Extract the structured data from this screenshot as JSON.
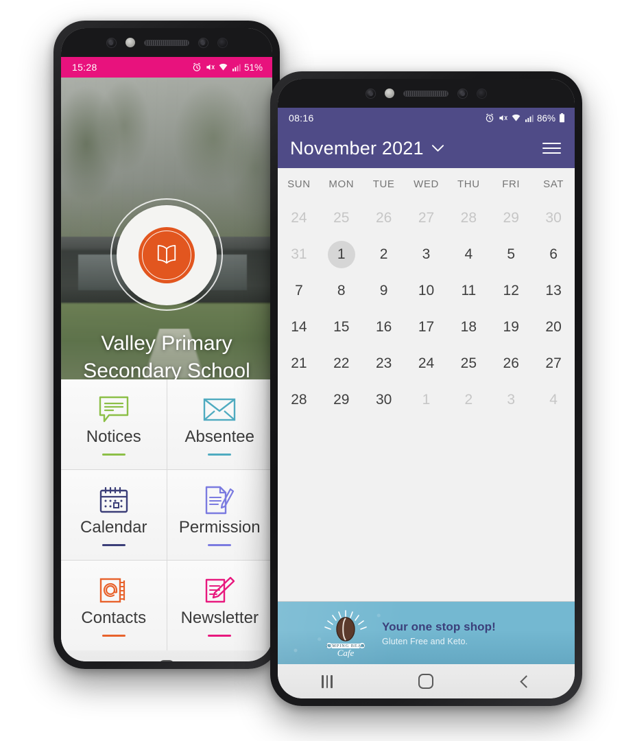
{
  "left_phone": {
    "status_bar": {
      "time": "15:28",
      "battery_text": "51%",
      "bg_color": "#e8127d",
      "icons": [
        "alarm-icon",
        "mute-icon",
        "wifi-icon",
        "signal-icon",
        "battery-icon"
      ]
    },
    "hero": {
      "logo_icon": "open-book-icon",
      "logo_color": "#e2561f",
      "school_name_line1": "Valley Primary",
      "school_name_line2": "Secondary School"
    },
    "tiles": [
      {
        "label": "Notices",
        "icon": "speech-bubble-icon",
        "color": "#8cbf47"
      },
      {
        "label": "Absentee",
        "icon": "envelope-icon",
        "color": "#4fabc0"
      },
      {
        "label": "Calendar",
        "icon": "calendar-icon",
        "color": "#3b3e78"
      },
      {
        "label": "Permission",
        "icon": "document-pen-icon",
        "color": "#7b7be0"
      },
      {
        "label": "Contacts",
        "icon": "at-address-book-icon",
        "color": "#e8622c"
      },
      {
        "label": "Newsletter",
        "icon": "note-pencil-icon",
        "color": "#e8197e"
      }
    ],
    "nav": {
      "recent": "recent-apps-icon",
      "home": "home-icon",
      "back": "back-icon"
    }
  },
  "right_phone": {
    "status_bar": {
      "time": "08:16",
      "battery_text": "86%",
      "bg_color": "#4f4b87",
      "icons": [
        "alarm-icon",
        "mute-icon",
        "wifi-icon",
        "signal-icon",
        "battery-icon"
      ]
    },
    "header": {
      "title": "November 2021",
      "dropdown_icon": "chevron-down-icon",
      "menu_icon": "hamburger-menu-icon",
      "bg_color": "#4f4b87"
    },
    "calendar": {
      "weekdays": [
        "SUN",
        "MON",
        "TUE",
        "WED",
        "THU",
        "FRI",
        "SAT"
      ],
      "selected_day": 1,
      "weeks": [
        [
          {
            "n": "24",
            "muted": true
          },
          {
            "n": "25",
            "muted": true
          },
          {
            "n": "26",
            "muted": true
          },
          {
            "n": "27",
            "muted": true
          },
          {
            "n": "28",
            "muted": true
          },
          {
            "n": "29",
            "muted": true
          },
          {
            "n": "30",
            "muted": true
          }
        ],
        [
          {
            "n": "31",
            "muted": true
          },
          {
            "n": "1",
            "muted": false,
            "selected": true
          },
          {
            "n": "2",
            "muted": false
          },
          {
            "n": "3",
            "muted": false
          },
          {
            "n": "4",
            "muted": false
          },
          {
            "n": "5",
            "muted": false
          },
          {
            "n": "6",
            "muted": false
          }
        ],
        [
          {
            "n": "7",
            "muted": false
          },
          {
            "n": "8",
            "muted": false
          },
          {
            "n": "9",
            "muted": false
          },
          {
            "n": "10",
            "muted": false
          },
          {
            "n": "11",
            "muted": false
          },
          {
            "n": "12",
            "muted": false
          },
          {
            "n": "13",
            "muted": false
          }
        ],
        [
          {
            "n": "14",
            "muted": false
          },
          {
            "n": "15",
            "muted": false
          },
          {
            "n": "16",
            "muted": false
          },
          {
            "n": "17",
            "muted": false
          },
          {
            "n": "18",
            "muted": false
          },
          {
            "n": "19",
            "muted": false
          },
          {
            "n": "20",
            "muted": false
          }
        ],
        [
          {
            "n": "21",
            "muted": false
          },
          {
            "n": "22",
            "muted": false
          },
          {
            "n": "23",
            "muted": false
          },
          {
            "n": "24",
            "muted": false
          },
          {
            "n": "25",
            "muted": false
          },
          {
            "n": "26",
            "muted": false
          },
          {
            "n": "27",
            "muted": false
          }
        ],
        [
          {
            "n": "28",
            "muted": false
          },
          {
            "n": "29",
            "muted": false
          },
          {
            "n": "30",
            "muted": false
          },
          {
            "n": "1",
            "muted": true
          },
          {
            "n": "2",
            "muted": true
          },
          {
            "n": "3",
            "muted": true
          },
          {
            "n": "4",
            "muted": true
          }
        ]
      ]
    },
    "ad_banner": {
      "headline": "Your one stop shop!",
      "subtext": "Gluten Free and Keto.",
      "logo_icon": "coffee-bean-icon",
      "logo_brand": "JUMPING BEAN",
      "logo_script": "Cafe",
      "bg_color": "#74b8d1"
    },
    "nav": {
      "recent": "recent-apps-icon",
      "home": "home-icon",
      "back": "back-icon"
    }
  }
}
